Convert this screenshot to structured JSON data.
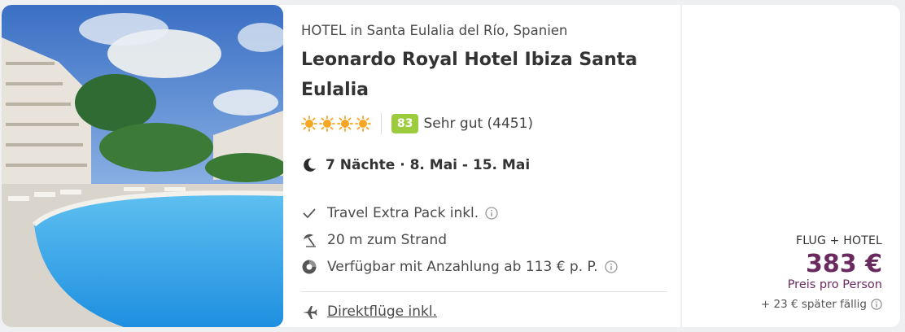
{
  "hotel": {
    "location": "HOTEL in Santa Eulalia del Río, Spanien",
    "name": "Leonardo Royal Hotel Ibiza Santa Eulalia",
    "stars": 4,
    "score": "83",
    "score_text": "Sehr gut (4451)",
    "dates": "7 Nächte · 8. Mai - 15. Mai"
  },
  "features": [
    {
      "icon": "check-icon",
      "label": "Travel Extra Pack inkl.",
      "info": true
    },
    {
      "icon": "beach-umbrella-icon",
      "label": "20 m zum Strand",
      "info": false
    },
    {
      "icon": "deposit-icon",
      "label": "Verfügbar mit Anzahlung ab 113 € p. P.",
      "info": true
    }
  ],
  "flight": {
    "label": "Direktflüge inkl."
  },
  "price": {
    "type": "FLUG + HOTEL",
    "amount": "383 €",
    "per_person": "Preis pro Person",
    "later": "+ 23 € später fällig"
  },
  "colors": {
    "score_badge": "#9ccc3c",
    "price": "#6b2a5f",
    "stars": "#f5a623"
  }
}
